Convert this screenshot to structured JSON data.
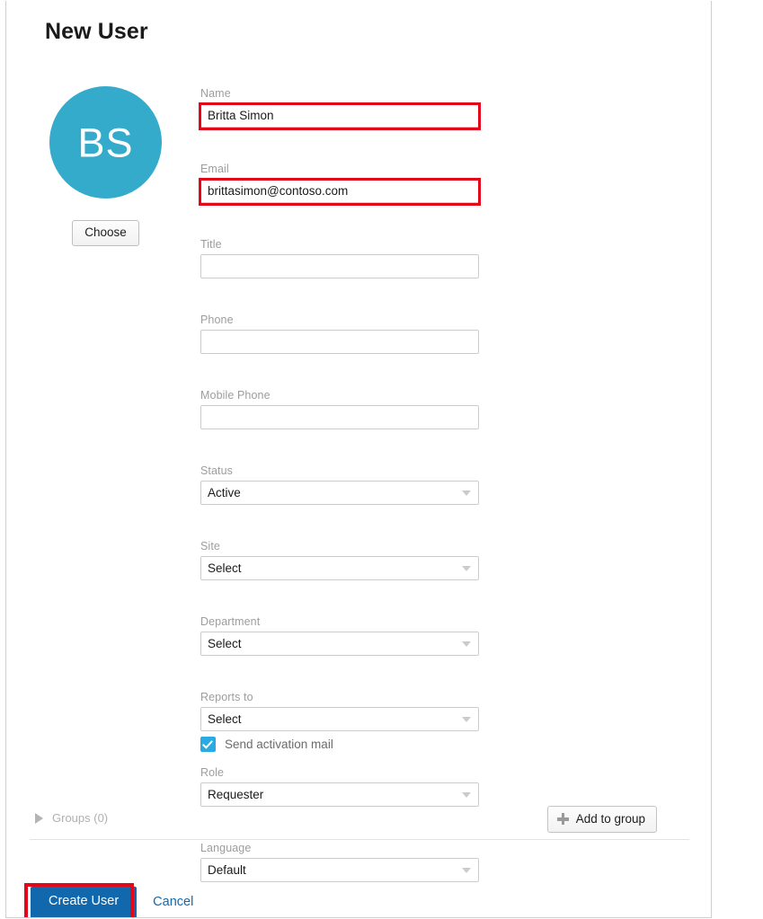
{
  "page": {
    "title": "New User"
  },
  "avatar": {
    "initials": "BS",
    "color": "#35abcc",
    "choose_label": "Choose"
  },
  "form": {
    "fields": [
      {
        "label": "Name",
        "value": "Britta Simon",
        "type": "text",
        "highlighted": true
      },
      {
        "label": "Email",
        "value": "brittasimon@contoso.com",
        "type": "text",
        "highlighted": true
      },
      {
        "label": "Title",
        "value": "",
        "type": "text",
        "highlighted": false
      },
      {
        "label": "Phone",
        "value": "",
        "type": "text",
        "highlighted": false
      },
      {
        "label": "Mobile Phone",
        "value": "",
        "type": "text",
        "highlighted": false
      },
      {
        "label": "Status",
        "value": "Active",
        "type": "select",
        "highlighted": false
      },
      {
        "label": "Site",
        "value": "Select",
        "type": "select",
        "highlighted": false
      },
      {
        "label": "Department",
        "value": "Select",
        "type": "select",
        "highlighted": false
      },
      {
        "label": "Reports to",
        "value": "Select",
        "type": "select",
        "highlighted": false
      },
      {
        "label": "Role",
        "value": "Requester",
        "type": "select",
        "highlighted": false
      },
      {
        "label": "Language",
        "value": "Default",
        "type": "select",
        "highlighted": false
      }
    ],
    "activation": {
      "label": "Send activation mail",
      "checked": true,
      "color": "#29abe2"
    }
  },
  "groups": {
    "label": "Groups (0)",
    "count": 0,
    "expanded": false,
    "add_button_label": "Add to group"
  },
  "footer": {
    "create_label": "Create User",
    "cancel_label": "Cancel",
    "create_color": "#1268ad"
  },
  "annotations": {
    "highlight_color": "#e3071b"
  }
}
